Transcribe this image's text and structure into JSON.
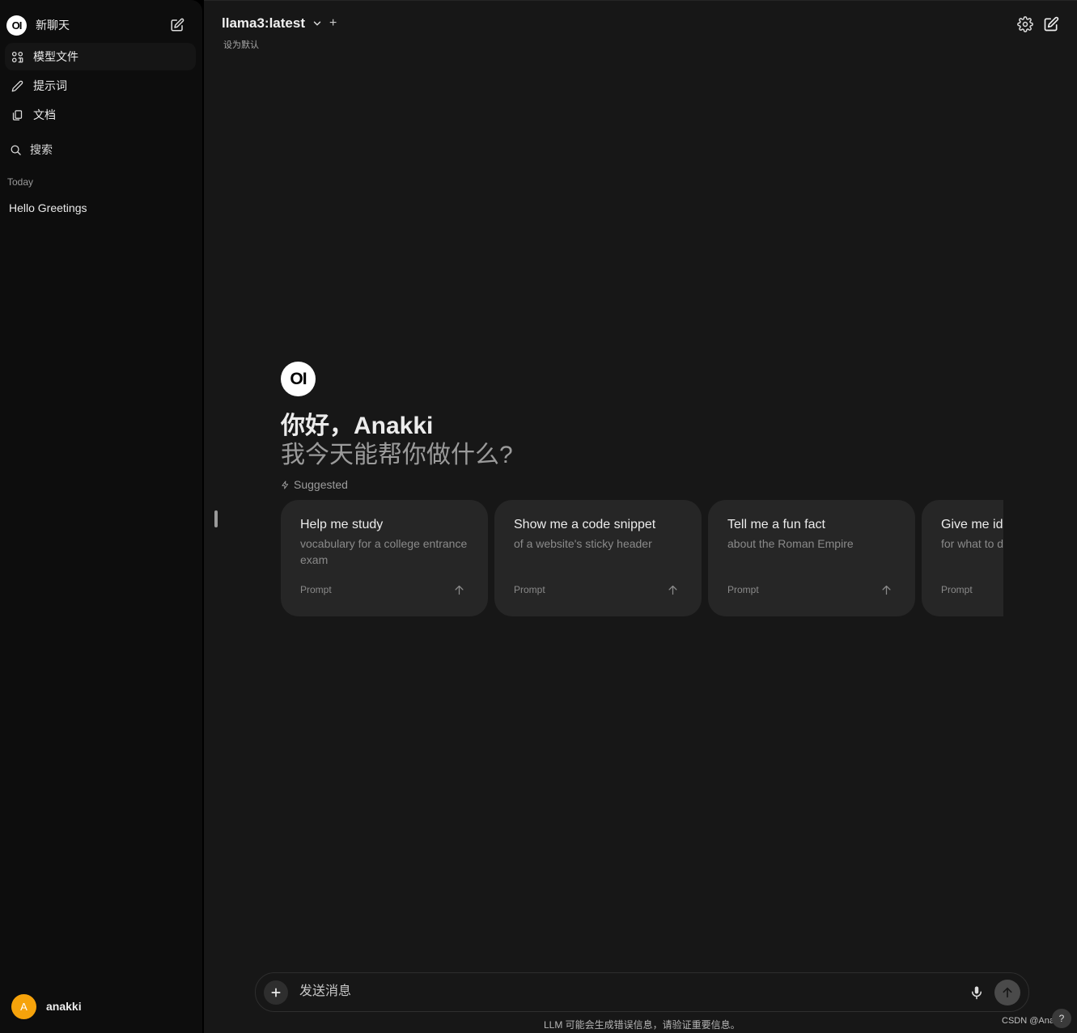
{
  "sidebar": {
    "logo_text": "OI",
    "new_chat_label": "新聊天",
    "items": [
      {
        "label": "模型文件",
        "icon": "grid-icon"
      },
      {
        "label": "提示词",
        "icon": "pencil-icon"
      },
      {
        "label": "文档",
        "icon": "documents-icon"
      }
    ],
    "search_label": "搜索",
    "section_today": "Today",
    "chats": [
      {
        "title": "Hello Greetings"
      }
    ],
    "user": {
      "initial": "A",
      "name": "anakki",
      "avatar_color": "#f6a30b"
    }
  },
  "header": {
    "model_name": "llama3:latest",
    "add_symbol": "+",
    "set_default": "设为默认"
  },
  "welcome": {
    "logo_text": "OI",
    "greeting": "你好，Anakki",
    "subtitle": "我今天能帮你做什么?",
    "suggested_label": "Suggested"
  },
  "suggestions": [
    {
      "title": "Help me study",
      "desc": "vocabulary for a college entrance exam",
      "foot": "Prompt"
    },
    {
      "title": "Show me a code snippet",
      "desc": "of a website's sticky header",
      "foot": "Prompt"
    },
    {
      "title": "Tell me a fun fact",
      "desc": "about the Roman Empire",
      "foot": "Prompt"
    },
    {
      "title": "Give me ideas",
      "desc": "for what to do with my kids' art",
      "foot": "Prompt"
    }
  ],
  "composer": {
    "placeholder": "发送消息",
    "disclaimer": "LLM 可能会生成错误信息，请验证重要信息。"
  },
  "watermark": "CSDN @Anakki",
  "help_label": "?"
}
